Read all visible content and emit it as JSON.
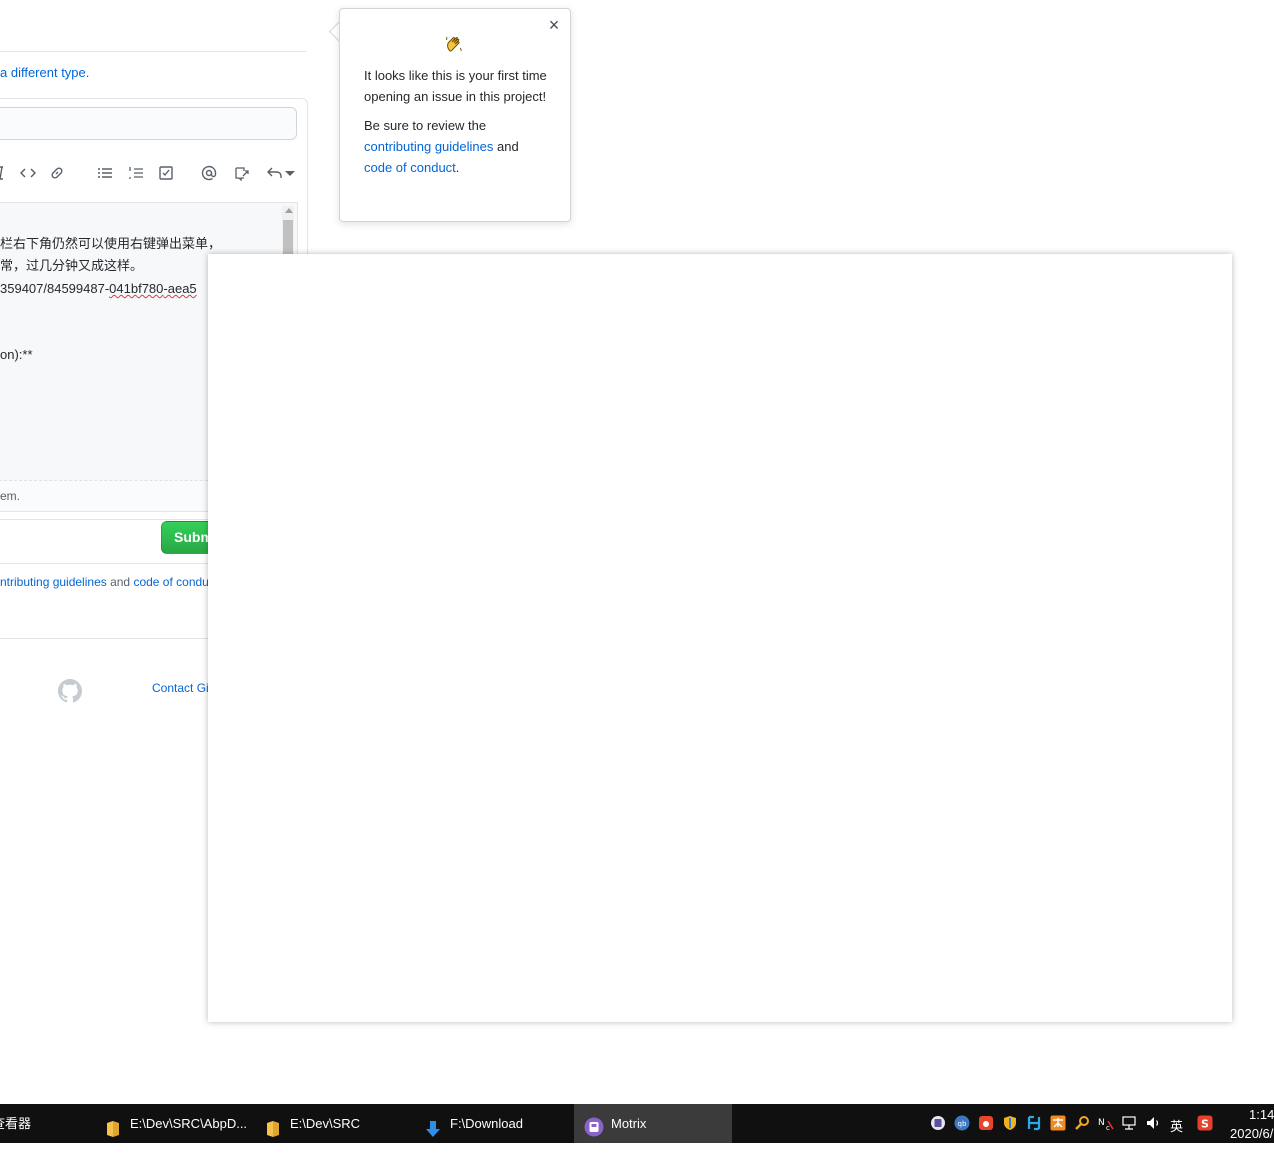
{
  "page": {
    "type_link": "a different type.",
    "comment_lines": {
      "line1": "栏右下角仍然可以使用右键弹出菜单，",
      "line2": "常，过几分钟又成这样。",
      "line3_a": "359407/84599487-",
      "line3_b": "041bf780",
      "line3_c": "-aea5",
      "line4": "on):**"
    },
    "attach_text": "em.",
    "submit_label": "Submit new issue",
    "guidelines": {
      "link1": "ntributing guidelines",
      "and": " and ",
      "link2": "code of condu"
    },
    "contact": "Contact Gi"
  },
  "popover": {
    "close_glyph": "×",
    "para1": "It looks like this is your first time opening an issue in this project!",
    "para2_prefix": "Be sure to review the ",
    "link1": "contributing guidelines",
    "para2_and": " and ",
    "link2": "code of conduct",
    "para2_suffix": "."
  },
  "taskbar": {
    "items": [
      {
        "label": "查看器",
        "icon": "viewer-icon"
      },
      {
        "label": "E:\\Dev\\SRC\\AbpD...",
        "icon": "folder-icon"
      },
      {
        "label": "E:\\Dev\\SRC",
        "icon": "folder-icon"
      },
      {
        "label": "F:\\Download",
        "icon": "download-arrow-icon"
      },
      {
        "label": "Motrix",
        "icon": "motrix-icon"
      }
    ],
    "ime": "英",
    "time": "1:14",
    "date": "2020/6/"
  },
  "colors": {
    "link": "#0366d6",
    "submit": "#2ea44f",
    "taskbar": "#101010",
    "taskbar_active": "#3b3b3b"
  }
}
